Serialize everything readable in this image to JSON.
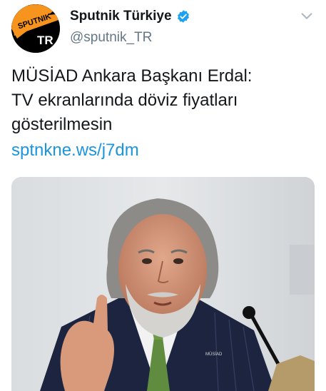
{
  "account": {
    "display_name": "Sputnik Türkiye",
    "handle": "@sputnik_TR",
    "verified": true,
    "verified_icon": "verified-badge-icon",
    "avatar": {
      "logo_text_top": "SPUTNIK",
      "logo_text_bottom": "TR",
      "accent": "#f7941d",
      "background": "#000000"
    }
  },
  "menu_icon": "chevron-down-icon",
  "tweet": {
    "lines": [
      "MÜSİAD Ankara Başkanı Erdal:",
      "TV ekranlarında döviz fiyatları",
      "gösterilmesin"
    ],
    "link": "sptnkne.ws/j7dm"
  },
  "media": {
    "type": "photo",
    "badge_text": "MÜSİAD"
  },
  "colors": {
    "text": "#14171a",
    "secondary": "#657786",
    "link": "#1b95e0",
    "verified": "#1da1f2"
  }
}
